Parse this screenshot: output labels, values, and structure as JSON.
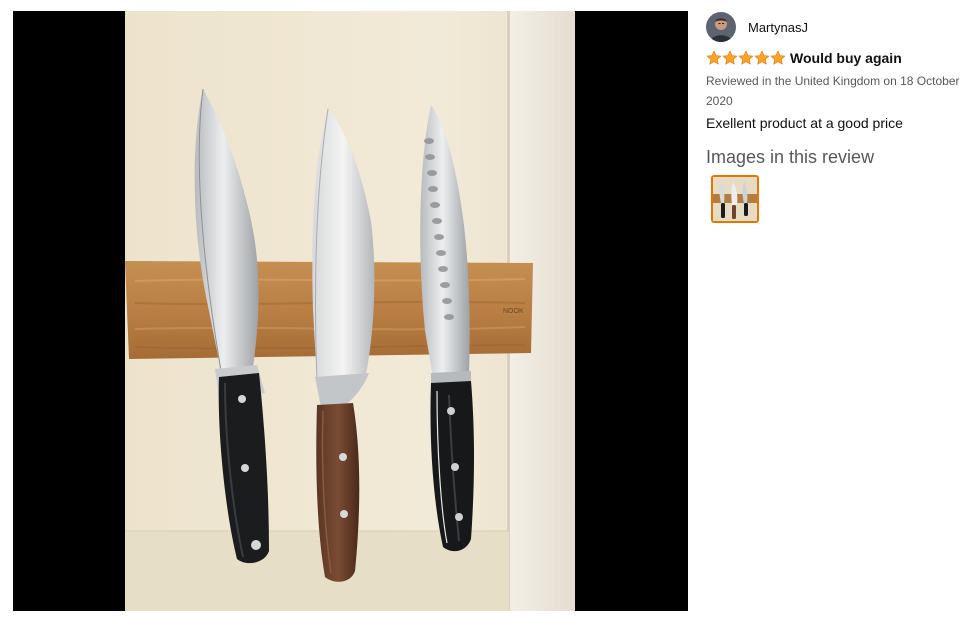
{
  "viewer": {
    "image_icon": "review-photo-knives-on-magnetic-strip"
  },
  "reviewer": {
    "name": "MartynasJ",
    "avatar_icon": "user-avatar"
  },
  "review": {
    "rating": 5,
    "rating_max": 5,
    "title": "Would buy again",
    "date_line": "Reviewed in the United Kingdom on 18 October 2020",
    "body": "Exellent product at a good price",
    "images_heading": "Images in this review",
    "star_icon": "star-icon"
  },
  "colors": {
    "star": "#ffa41c",
    "star_outline": "#de7921",
    "thumb_border": "#e77600",
    "muted_text": "#565959",
    "text": "#0f1111",
    "viewer_bg": "#000000"
  }
}
